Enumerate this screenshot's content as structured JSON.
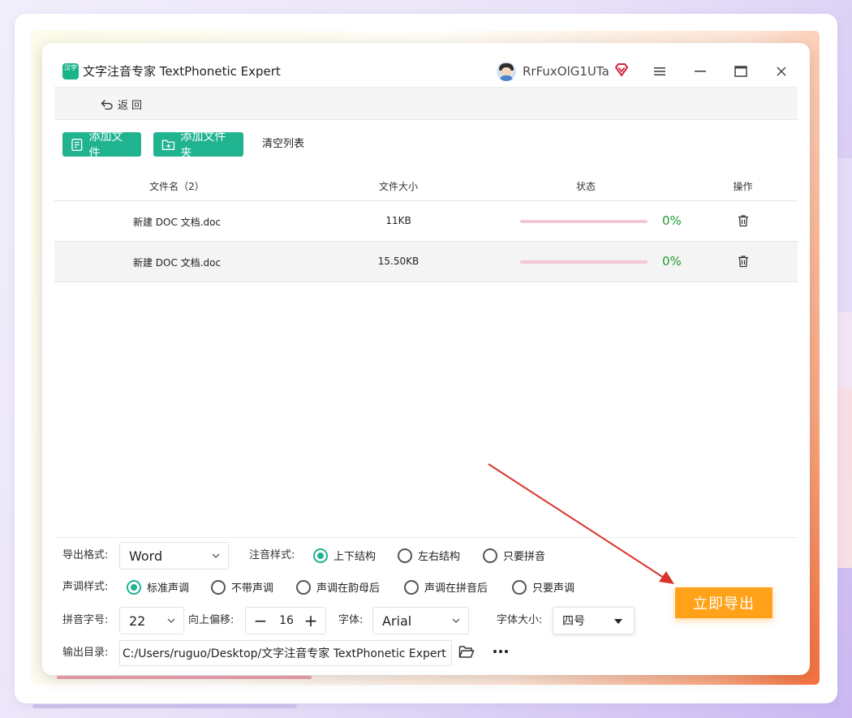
{
  "app": {
    "logo_text": "汉字",
    "title": "文字注音专家 TextPhonetic Expert",
    "username": "RrFuxOlG1UTa"
  },
  "nav": {
    "back_label": "返回"
  },
  "toolbar": {
    "add_file_label": "添加文件",
    "add_folder_label": "添加文件夹",
    "clear_list_label": "清空列表"
  },
  "table": {
    "headers": {
      "name": "文件名（2）",
      "size": "文件大小",
      "status": "状态",
      "ops": "操作"
    },
    "rows": [
      {
        "name": "新建 DOC 文档.doc",
        "size": "11KB",
        "progress_text": "0%",
        "progress": 0
      },
      {
        "name": "新建 DOC 文档.doc",
        "size": "15.50KB",
        "progress_text": "0%",
        "progress": 0
      }
    ]
  },
  "options": {
    "export_format": {
      "label": "导出格式:",
      "value": "Word"
    },
    "annotation_style": {
      "label": "注音样式:",
      "options": [
        "上下结构",
        "左右结构",
        "只要拼音"
      ],
      "selected": "上下结构"
    },
    "tone_style": {
      "label": "声调样式:",
      "options": [
        "标准声调",
        "不带声调",
        "声调在韵母后",
        "声调在拼音后",
        "只要声调"
      ],
      "selected": "标准声调"
    },
    "pinyin_size": {
      "label": "拼音字号:",
      "value": "22"
    },
    "offset": {
      "label": "向上偏移:",
      "value": "16"
    },
    "font": {
      "label": "字体:",
      "value": "Arial"
    },
    "font_size": {
      "label": "字体大小:",
      "value": "四号"
    },
    "output_dir": {
      "label": "输出目录:",
      "value": "C:/Users/ruguo/Desktop/文字注音专家 TextPhonetic Expert"
    }
  },
  "export_button": {
    "label": "立即导出"
  },
  "colors": {
    "accent": "#1fb390",
    "export": "#ffa21a",
    "progress_track": "#f2c8d2",
    "percent_text": "#1d9a2f",
    "arrow": "#d9342b"
  }
}
